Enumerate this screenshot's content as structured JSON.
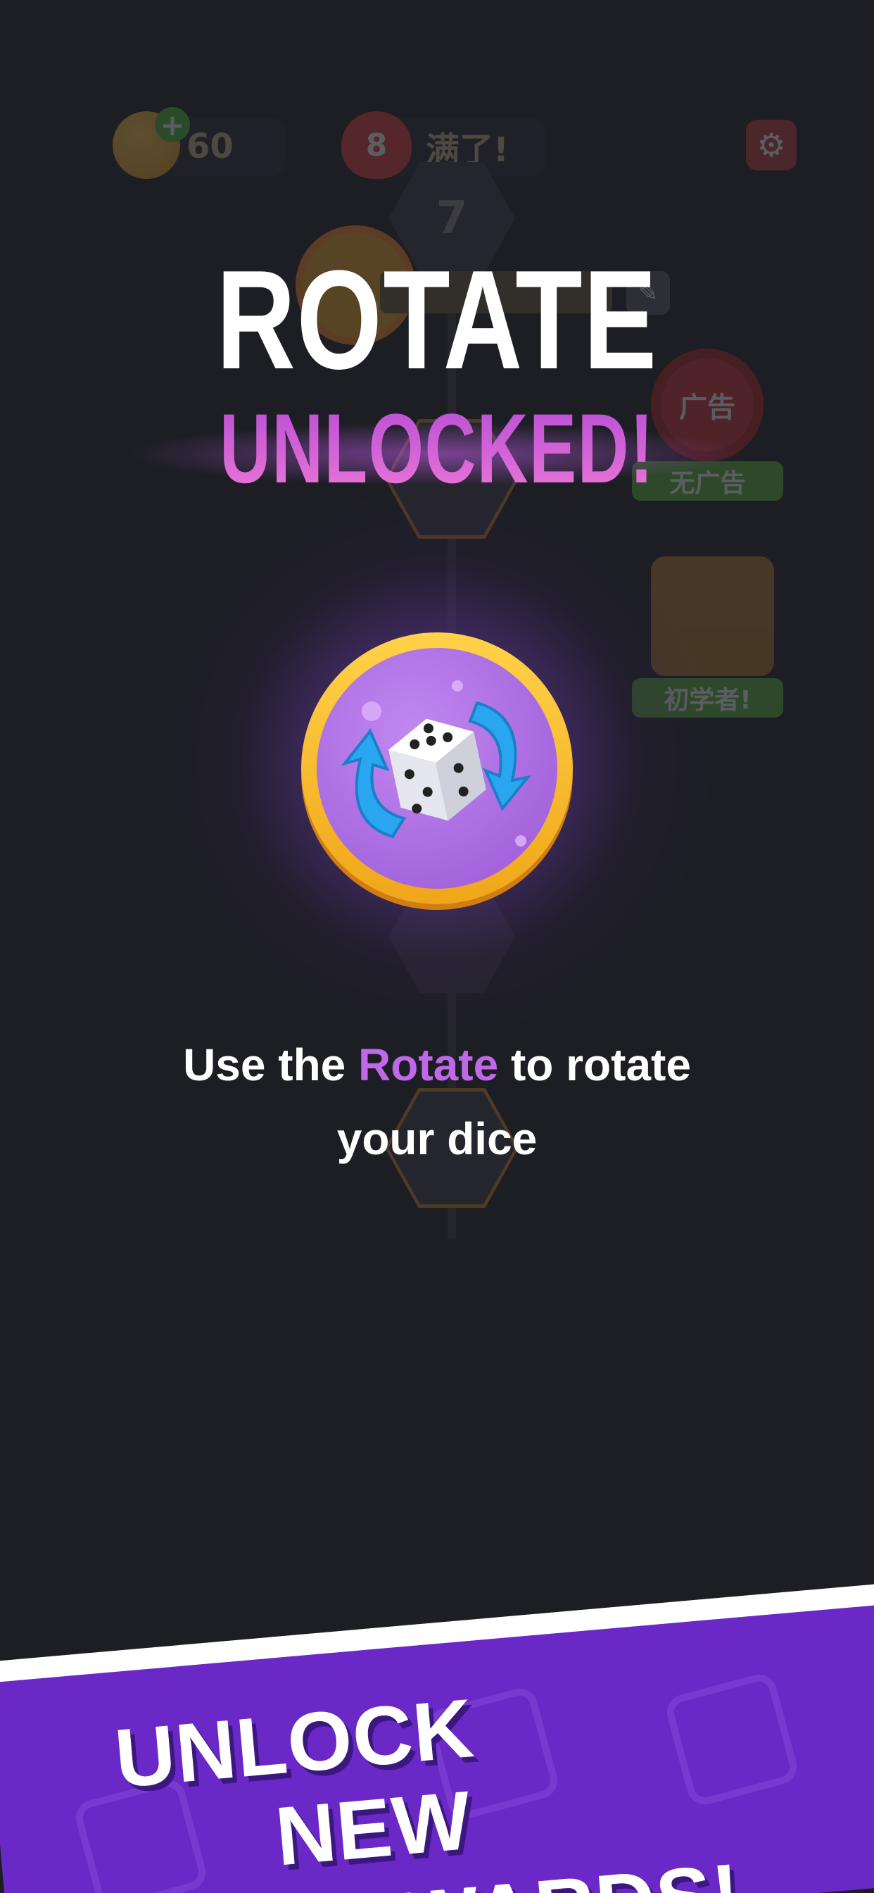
{
  "background": {
    "coins": "60",
    "lives": "8",
    "lives_status": "满了!",
    "level_top": "7",
    "no_ads_icon_text": "广告",
    "no_ads_label": "无广告",
    "beginner_label": "初学者!"
  },
  "title": {
    "line1": "ROTATE",
    "line2": "UNLOCKED!"
  },
  "description": {
    "prefix": "Use the ",
    "highlight": "Rotate",
    "suffix": " to rotate",
    "line2": "your dice"
  },
  "banner": {
    "line1": "UNLOCK",
    "line2": "NEW REWARDS!"
  },
  "colors": {
    "background": "#1d1e24",
    "accent_purple": "#c069e8",
    "badge_gold": "#f0a619",
    "banner_purple": "#6a28c6"
  },
  "icons": {
    "badge": "rotate-dice-icon",
    "settings": "gear-icon",
    "edit": "pencil-icon"
  }
}
